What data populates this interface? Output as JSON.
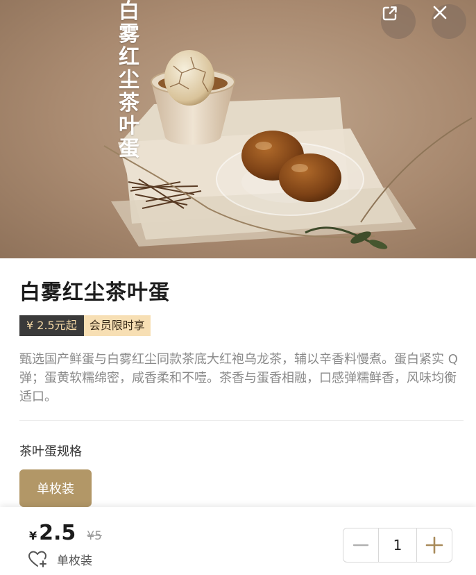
{
  "hero": {
    "vertical_title_chars": [
      "白",
      "雾",
      "红",
      "尘",
      "茶",
      "叶",
      "蛋"
    ],
    "share_icon": "share-icon",
    "close_icon": "close-icon"
  },
  "product": {
    "title": "白雾红尘茶叶蛋",
    "price_tag": "¥ 2.5元起",
    "member_tag": "会员限时享",
    "description": "甄选国产鲜蛋与白雾红尘同款茶底大红袍乌龙茶，辅以辛香料慢煮。蛋白紧实 Q 弹；蛋黄软糯绵密，咸香柔和不噎。茶香与蛋香相融，口感弹糯鲜香，风味均衡适口。"
  },
  "spec": {
    "title": "茶叶蛋规格",
    "options": [
      "单枚装"
    ],
    "selected": "单枚装"
  },
  "bottom": {
    "currency": "¥",
    "price": "2.5",
    "original_price": "¥5",
    "selected_spec": "单枚装",
    "quantity": "1",
    "fav_icon": "heart-plus-icon",
    "minus_icon": "minus-icon",
    "plus_icon": "plus-icon"
  },
  "colors": {
    "accent": "#b29767",
    "tag_dark": "#3a3a3a",
    "tag_light": "#f7dfb4",
    "plus_icon": "#a88a5a"
  }
}
